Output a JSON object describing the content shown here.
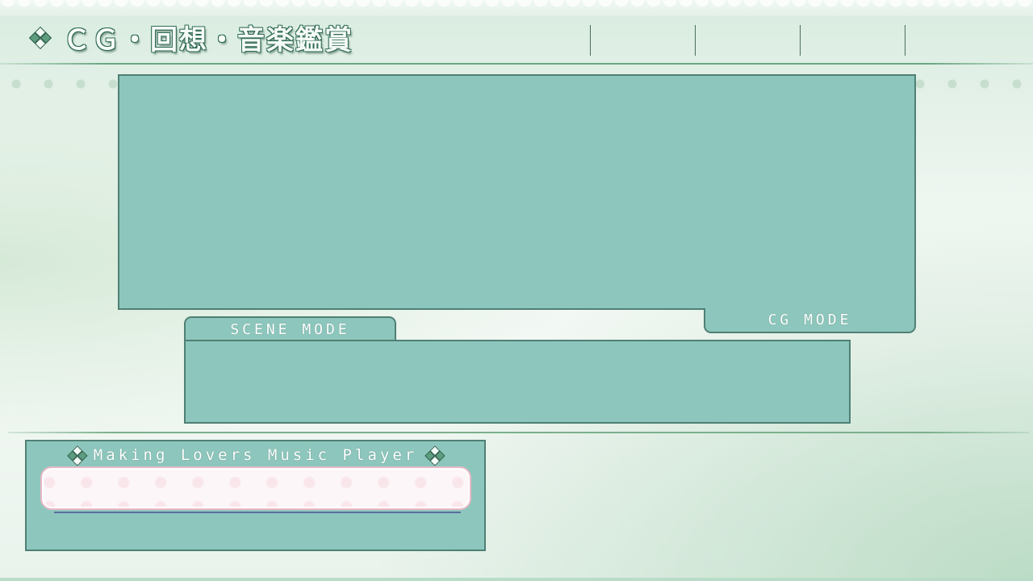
{
  "header": {
    "title": "ＣＧ・回想・音楽鑑賞",
    "nav_items": [
      "",
      "",
      "",
      ""
    ]
  },
  "modes": {
    "cg_tab_label": "CG MODE",
    "scene_tab_label": "SCENE MODE"
  },
  "player": {
    "title": "Making Lovers Music Player",
    "current_track": ""
  },
  "colors": {
    "panel_fill": "#8dc6bc",
    "panel_border": "#4f8074",
    "accent_line": "#6aa882",
    "track_display_border": "#e8b9c7"
  }
}
